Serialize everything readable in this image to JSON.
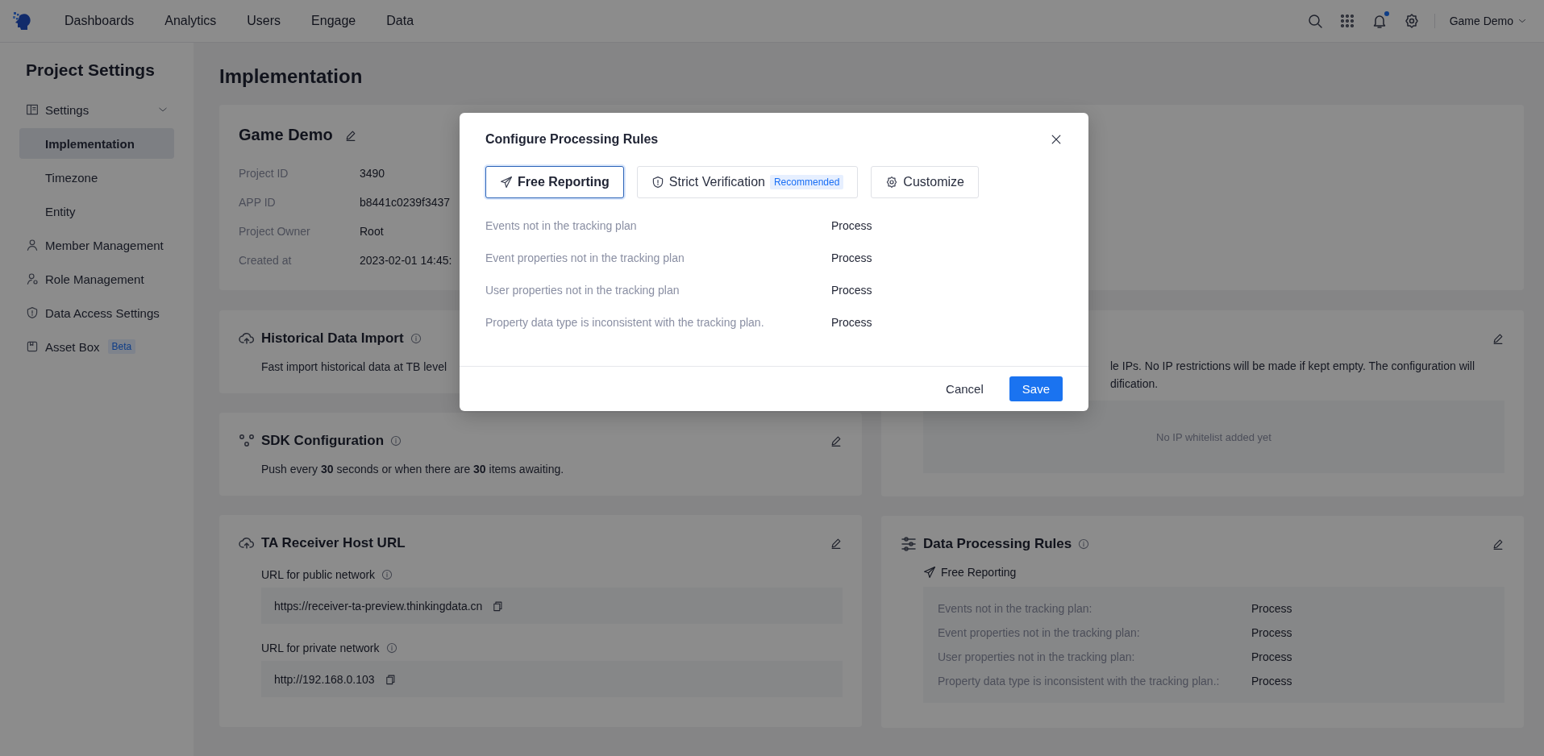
{
  "top_bar": {
    "nav": [
      {
        "label": "Dashboards",
        "selected": false
      },
      {
        "label": "Analytics",
        "selected": false
      },
      {
        "label": "Users",
        "selected": false
      },
      {
        "label": "Engage",
        "selected": false
      },
      {
        "label": "Data",
        "selected": false
      }
    ],
    "has_unread": true,
    "project_switcher": "Game Demo"
  },
  "sidebar": {
    "title": "Project Settings",
    "items": [
      {
        "label": "Settings",
        "selected": false,
        "expanded": true,
        "children": [
          {
            "label": "Implementation",
            "selected": true
          },
          {
            "label": "Timezone",
            "selected": false
          },
          {
            "label": "Entity",
            "selected": false
          }
        ]
      },
      {
        "label": "Member Management",
        "selected": false
      },
      {
        "label": "Role Management",
        "selected": false
      },
      {
        "label": "Data Access Settings",
        "selected": false
      },
      {
        "label": "Asset Box",
        "selected": false,
        "badge": "Beta"
      }
    ]
  },
  "page": {
    "title": "Implementation",
    "project_card": {
      "name": "Game Demo",
      "fields": [
        {
          "label": "Project ID",
          "value": "3490"
        },
        {
          "label": "APP ID",
          "value": "b8441c0239f3437"
        },
        {
          "label": "Project Owner",
          "value": "Root"
        },
        {
          "label": "Created at",
          "value": "2023-02-01 14:45:"
        }
      ]
    },
    "historical_import": {
      "title": "Historical Data Import",
      "description": "Fast import historical data at TB level"
    },
    "sdk_configuration": {
      "title": "SDK Configuration",
      "description": "Push every **30** seconds or when there are **30** items awaiting."
    },
    "receiver_host": {
      "title": "TA Receiver Host URL",
      "urls": [
        {
          "label": "URL for public network",
          "value": "https://receiver-ta-preview.thinkingdata.cn"
        },
        {
          "label": "URL for private network",
          "value": "http://192.168.0.103"
        }
      ]
    },
    "ip_whitelist": {
      "description_lines": [
        "le IPs. No IP restrictions will be made if kept empty. The configuration will",
        "dification."
      ],
      "empty_text": "No IP whitelist added yet"
    },
    "processing_rules": {
      "title": "Data Processing Rules",
      "mode": "Free Reporting",
      "rules": [
        {
          "label": "Events not in the tracking plan:",
          "value": "Process"
        },
        {
          "label": "Event properties not in the tracking plan:",
          "value": "Process"
        },
        {
          "label": "User properties not in the tracking plan:",
          "value": "Process"
        },
        {
          "label": "Property data type is inconsistent with the tracking plan.:",
          "value": "Process"
        }
      ]
    }
  },
  "modal": {
    "title": "Configure Processing Rules",
    "options": [
      {
        "label": "Free Reporting",
        "selected": true
      },
      {
        "label": "Strict Verification",
        "selected": false,
        "badge": "Recommended"
      },
      {
        "label": "Customize",
        "selected": false
      }
    ],
    "rules": [
      {
        "label": "Events not in the tracking plan",
        "value": "Process"
      },
      {
        "label": "Event properties not in the tracking plan",
        "value": "Process"
      },
      {
        "label": "User properties not in the tracking plan",
        "value": "Process"
      },
      {
        "label": "Property data type is inconsistent with the tracking plan.",
        "value": "Process"
      }
    ],
    "buttons": [
      {
        "label": "Cancel",
        "kind": "secondary"
      },
      {
        "label": "Save",
        "kind": "primary"
      }
    ]
  }
}
